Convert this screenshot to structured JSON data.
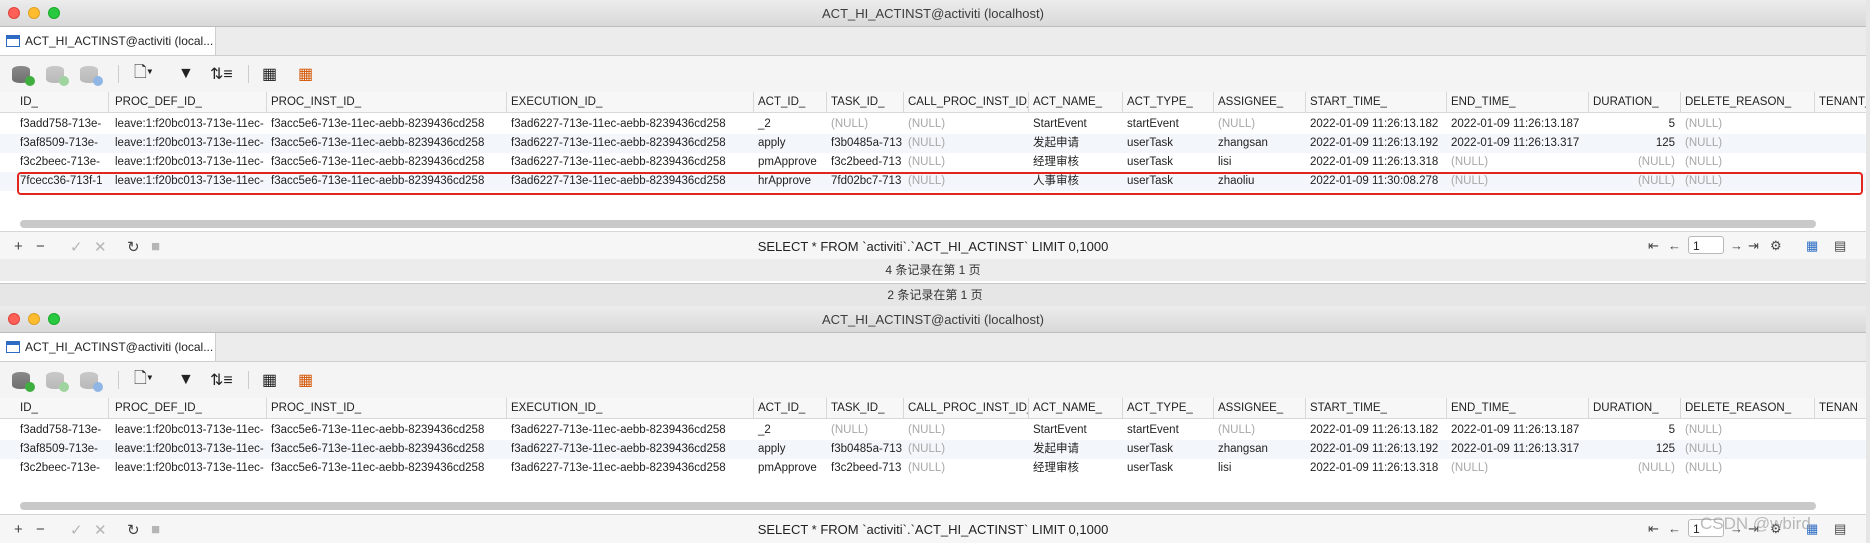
{
  "window1": {
    "title": "ACT_HI_ACTINST@activiti (localhost)",
    "tab": "ACT_HI_ACTINST@activiti (local...",
    "columns": [
      "ID_",
      "PROC_DEF_ID_",
      "PROC_INST_ID_",
      "EXECUTION_ID_",
      "ACT_ID_",
      "TASK_ID_",
      "CALL_PROC_INST_ID_",
      "ACT_NAME_",
      "ACT_TYPE_",
      "ASSIGNEE_",
      "START_TIME_",
      "END_TIME_",
      "DURATION_",
      "DELETE_REASON_",
      "TENANT_"
    ],
    "sort_indicator": "^",
    "rows": [
      [
        "f3add758-713e-",
        "leave:1:f20bc013-713e-11ec-",
        "f3acc5e6-713e-11ec-aebb-8239436cd258",
        "f3ad6227-713e-11ec-aebb-8239436cd258",
        "_2",
        "(NULL)",
        "(NULL)",
        "StartEvent",
        "startEvent",
        "(NULL)",
        "2022-01-09 11:26:13.182",
        "2022-01-09 11:26:13.187",
        "5",
        "(NULL)",
        ""
      ],
      [
        "f3af8509-713e-",
        "leave:1:f20bc013-713e-11ec-",
        "f3acc5e6-713e-11ec-aebb-8239436cd258",
        "f3ad6227-713e-11ec-aebb-8239436cd258",
        "apply",
        "f3b0485a-713",
        "(NULL)",
        "发起申请",
        "userTask",
        "zhangsan",
        "2022-01-09 11:26:13.192",
        "2022-01-09 11:26:13.317",
        "125",
        "(NULL)",
        ""
      ],
      [
        "f3c2beec-713e-",
        "leave:1:f20bc013-713e-11ec-",
        "f3acc5e6-713e-11ec-aebb-8239436cd258",
        "f3ad6227-713e-11ec-aebb-8239436cd258",
        "pmApprove",
        "f3c2beed-713",
        "(NULL)",
        "经理审核",
        "userTask",
        "lisi",
        "2022-01-09 11:26:13.318",
        "(NULL)",
        "(NULL)",
        "(NULL)",
        ""
      ],
      [
        "7fcecc36-713f-1",
        "leave:1:f20bc013-713e-11ec-",
        "f3acc5e6-713e-11ec-aebb-8239436cd258",
        "f3ad6227-713e-11ec-aebb-8239436cd258",
        "hrApprove",
        "7fd02bc7-713",
        "(NULL)",
        "人事审核",
        "userTask",
        "zhaoliu",
        "2022-01-09 11:30:08.278",
        "(NULL)",
        "(NULL)",
        "(NULL)",
        ""
      ]
    ],
    "sql": "SELECT * FROM `activiti`.`ACT_HI_ACTINST` LIMIT 0,1000",
    "page": "1",
    "status": "4 条记录在第 1 页"
  },
  "between_status": "2 条记录在第 1 页",
  "window2": {
    "title": "ACT_HI_ACTINST@activiti (localhost)",
    "tab": "ACT_HI_ACTINST@activiti (local...",
    "columns": [
      "ID_",
      "PROC_DEF_ID_",
      "PROC_INST_ID_",
      "EXECUTION_ID_",
      "ACT_ID_",
      "TASK_ID_",
      "CALL_PROC_INST_ID_",
      "ACT_NAME_",
      "ACT_TYPE_",
      "ASSIGNEE_",
      "START_TIME_",
      "END_TIME_",
      "DURATION_",
      "DELETE_REASON_",
      "TENAN"
    ],
    "rows": [
      [
        "f3add758-713e-",
        "leave:1:f20bc013-713e-11ec-",
        "f3acc5e6-713e-11ec-aebb-8239436cd258",
        "f3ad6227-713e-11ec-aebb-8239436cd258",
        "_2",
        "(NULL)",
        "(NULL)",
        "StartEvent",
        "startEvent",
        "(NULL)",
        "2022-01-09 11:26:13.182",
        "2022-01-09 11:26:13.187",
        "5",
        "(NULL)",
        ""
      ],
      [
        "f3af8509-713e-",
        "leave:1:f20bc013-713e-11ec-",
        "f3acc5e6-713e-11ec-aebb-8239436cd258",
        "f3ad6227-713e-11ec-aebb-8239436cd258",
        "apply",
        "f3b0485a-713",
        "(NULL)",
        "发起申请",
        "userTask",
        "zhangsan",
        "2022-01-09 11:26:13.192",
        "2022-01-09 11:26:13.317",
        "125",
        "(NULL)",
        ""
      ],
      [
        "f3c2beec-713e-",
        "leave:1:f20bc013-713e-11ec-",
        "f3acc5e6-713e-11ec-aebb-8239436cd258",
        "f3ad6227-713e-11ec-aebb-8239436cd258",
        "pmApprove",
        "f3c2beed-713",
        "(NULL)",
        "经理审核",
        "userTask",
        "lisi",
        "2022-01-09 11:26:13.318",
        "(NULL)",
        "(NULL)",
        "(NULL)",
        ""
      ]
    ],
    "sql": "SELECT * FROM `activiti`.`ACT_HI_ACTINST` LIMIT 0,1000",
    "page": "1"
  },
  "watermark": "CSDN @wbird",
  "icons": {
    "toolbar": [
      "db-add-icon",
      "db-commit-icon",
      "db-refresh-icon",
      "document-icon",
      "filter-icon",
      "sort-icon",
      "grid-export-icon",
      "grid-import-icon"
    ],
    "bottom": [
      "plus-icon",
      "minus-icon",
      "check-icon",
      "cancel-icon",
      "refresh-icon",
      "stop-icon"
    ],
    "pager": [
      "first-page-icon",
      "prev-page-icon",
      "next-page-icon",
      "last-page-icon",
      "gear-icon",
      "grid-view-icon",
      "form-view-icon"
    ]
  },
  "colors": {
    "highlight": "#e0261d",
    "null_text": "#a7a7a7"
  }
}
